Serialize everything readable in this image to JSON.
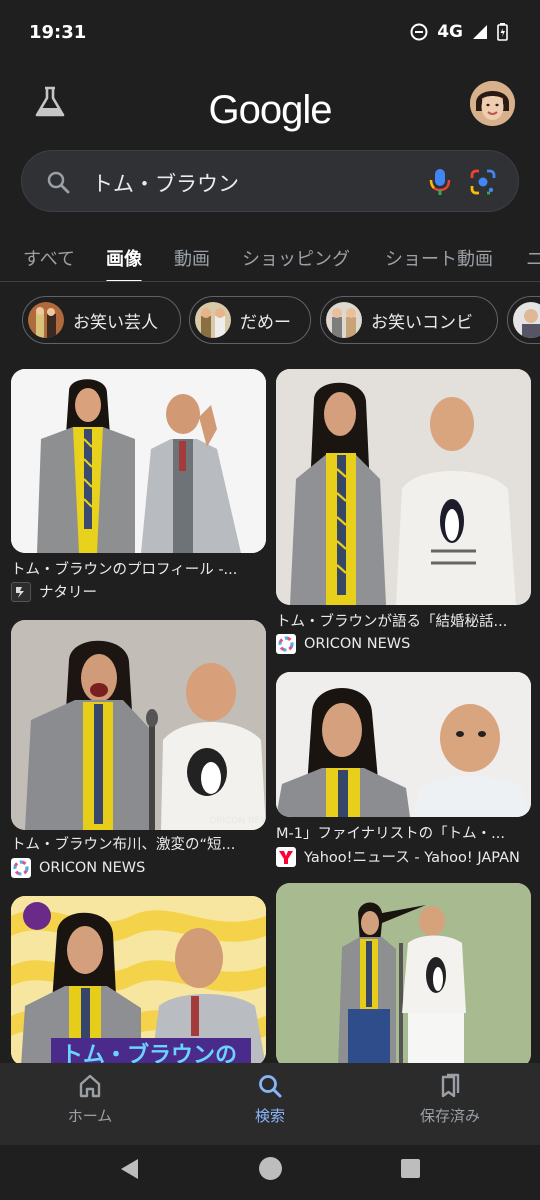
{
  "status": {
    "time": "19:31",
    "network": "4G"
  },
  "header": {
    "logo": "Google",
    "labs_icon": "flask-icon",
    "avatar_icon": "user-avatar"
  },
  "search": {
    "query": "トム・ブラウン",
    "icons": [
      "search-icon",
      "mic-icon",
      "lens-icon"
    ]
  },
  "tabs": [
    {
      "label": "すべて",
      "active": false
    },
    {
      "label": "画像",
      "active": true
    },
    {
      "label": "動画",
      "active": false
    },
    {
      "label": "ショッピング",
      "active": false
    },
    {
      "label": "ショート動画",
      "active": false
    },
    {
      "label": "ニ",
      "active": false
    }
  ],
  "chips": [
    {
      "label": "お笑い芸人"
    },
    {
      "label": "だめー"
    },
    {
      "label": "お笑いコンビ"
    }
  ],
  "results": [
    {
      "caption": "トム・ブラウンのプロフィール -...",
      "source": "ナタリー"
    },
    {
      "caption": "トム・ブラウンが語る「結婚秘話...",
      "source": "ORICON NEWS"
    },
    {
      "caption": "トム・ブラウン布川、激変の“短...",
      "source": "ORICON NEWS"
    },
    {
      "caption": "M-1」ファイナリストの「トム・...",
      "source": "Yahoo!ニュース - Yahoo! JAPAN"
    },
    {
      "caption": "",
      "source": ""
    },
    {
      "caption": "",
      "source": ""
    }
  ],
  "image_text": {
    "oricon_watermark": "ORICON NEWS",
    "banner_title": "トム・ブラウンの"
  },
  "bottom_nav": [
    {
      "label": "ホーム",
      "icon": "home-icon",
      "active": false
    },
    {
      "label": "検索",
      "icon": "search-icon",
      "active": true
    },
    {
      "label": "保存済み",
      "icon": "bookmarks-icon",
      "active": false
    }
  ],
  "system_nav": [
    "back-icon",
    "home-circle-icon",
    "recents-icon"
  ],
  "colors": {
    "background": "#1f1f1f",
    "accent": "#8ab4f8",
    "search_bg": "#303134"
  }
}
